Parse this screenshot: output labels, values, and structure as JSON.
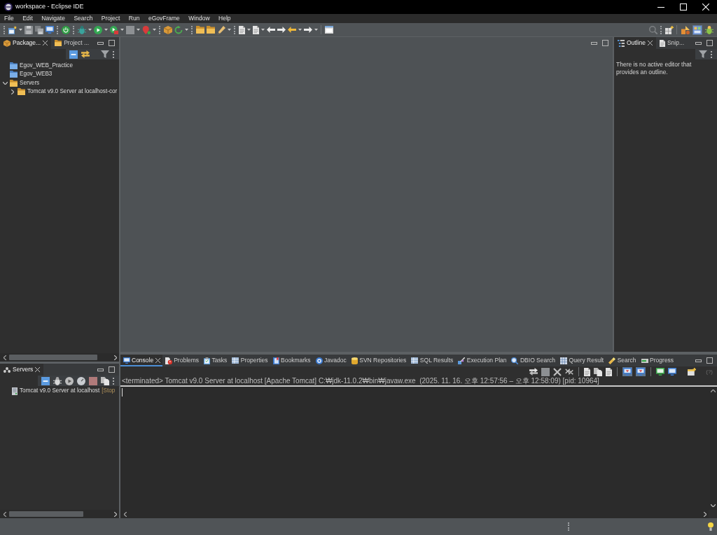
{
  "window": {
    "title": "workspace - Eclipse IDE"
  },
  "menu_bar": {
    "items": [
      "File",
      "Edit",
      "Navigate",
      "Search",
      "Project",
      "Run",
      "eGovFrame",
      "Window",
      "Help"
    ]
  },
  "toolbar": {
    "perspectives": [
      {
        "selected": false
      },
      {
        "selected": true
      },
      {
        "selected": false
      }
    ]
  },
  "package_explorer": {
    "tabs": [
      {
        "label": "Package...",
        "selected": true
      },
      {
        "label": "Project ...",
        "selected": false
      }
    ],
    "tree": [
      {
        "label": "Egov_WEB_Practice",
        "kind": "project"
      },
      {
        "label": "Egov_WEB3",
        "kind": "project"
      },
      {
        "label": "Servers",
        "kind": "folder",
        "expanded": true,
        "children": [
          {
            "label": "Tomcat v9.0 Server at localhost-cor",
            "kind": "folder",
            "expanded": false
          }
        ]
      }
    ]
  },
  "outline": {
    "tabs": [
      {
        "label": "Outline",
        "selected": true
      },
      {
        "label": "Snip...",
        "selected": false
      }
    ],
    "message": "There is no active editor that provides an outline."
  },
  "servers": {
    "tabs": [
      {
        "label": "Servers",
        "selected": true
      }
    ],
    "items": [
      {
        "name": "Tomcat v9.0 Server at localhost",
        "state": "[Stop"
      }
    ]
  },
  "console": {
    "tabs": [
      {
        "label": "Console",
        "selected": true
      },
      {
        "label": "Problems",
        "selected": false
      },
      {
        "label": "Tasks",
        "selected": false
      },
      {
        "label": "Properties",
        "selected": false
      },
      {
        "label": "Bookmarks",
        "selected": false
      },
      {
        "label": "Javadoc",
        "selected": false
      },
      {
        "label": "SVN Repositories",
        "selected": false
      },
      {
        "label": "SQL Results",
        "selected": false
      },
      {
        "label": "Execution Plan",
        "selected": false
      },
      {
        "label": "DBIO Search",
        "selected": false
      },
      {
        "label": "Query Result",
        "selected": false
      },
      {
        "label": "Search",
        "selected": false
      },
      {
        "label": "Progress",
        "selected": false
      }
    ],
    "toolbar_toggles": [
      {
        "on": true
      },
      {
        "on": true
      }
    ],
    "toolbar_hint": "(?)",
    "process_label": "<terminated> Tomcat v9.0 Server at localhost [Apache Tomcat] C:₩jdk-11.0.2₩bin₩javaw.exe  (2025. 11. 16. 오후 12:57:56 – 오후 12:58:09) [pid: 10964]"
  }
}
